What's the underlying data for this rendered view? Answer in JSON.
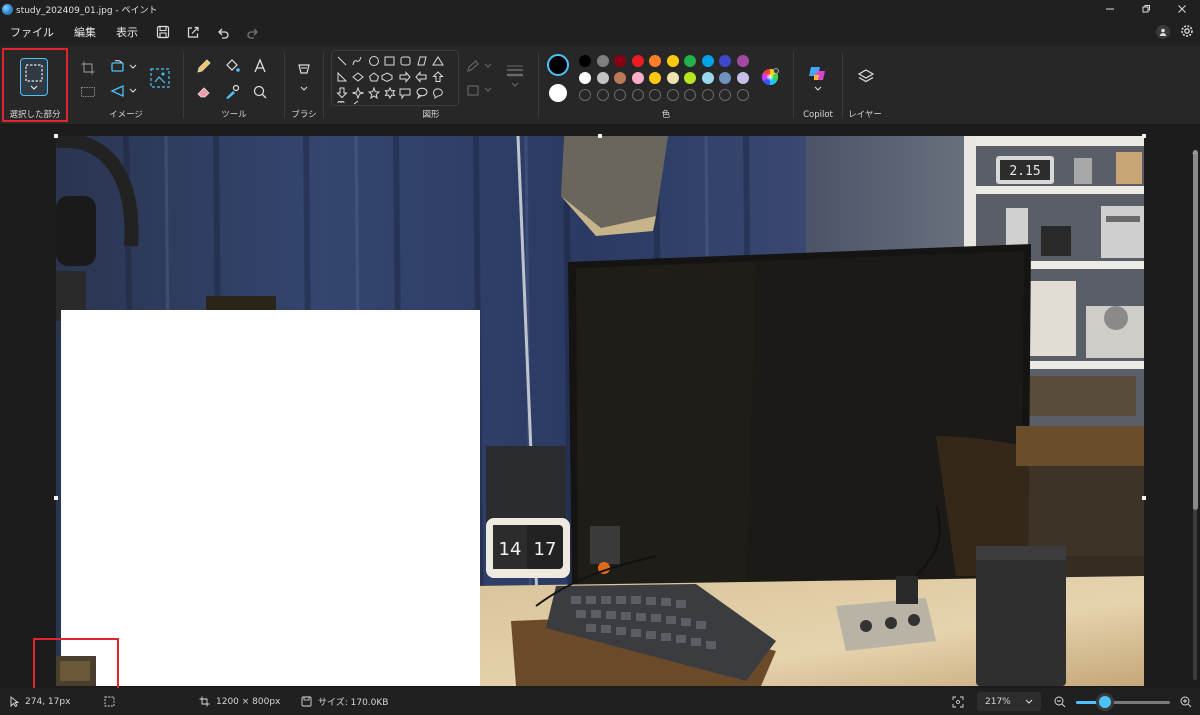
{
  "window": {
    "title": "study_202409_01.jpg - ペイント"
  },
  "menu": {
    "file": "ファイル",
    "edit": "編集",
    "view": "表示"
  },
  "ribbon": {
    "selection_label": "選択した部分",
    "image_label": "イメージ",
    "tools_label": "ツール",
    "brush_label": "ブラシ",
    "shapes_label": "図形",
    "color_label": "色",
    "copilot_label": "Copilot",
    "layers_label": "レイヤー"
  },
  "colors": {
    "primary": "#000000",
    "secondary": "#ffffff",
    "palette_row1": [
      "#000000",
      "#7f7f7f",
      "#880015",
      "#ed1c24",
      "#ff7f27",
      "#ffc90e",
      "#22b14c",
      "#00a2e8",
      "#3f48cc",
      "#a349a4"
    ],
    "palette_row2": [
      "#ffffff",
      "#c3c3c3",
      "#b97a57",
      "#ffaec9",
      "#ffc90e",
      "#efe4b0",
      "#b5e61d",
      "#99d9ea",
      "#7092be",
      "#c8bfe7"
    ],
    "accent": "#4cc2ff",
    "highlight": "#e0262c"
  },
  "canvas": {
    "clock_hours": "14",
    "clock_minutes": "17",
    "shelf_clock": "2.15"
  },
  "status": {
    "cursor_pos": "274, 17px",
    "image_size": "1200 × 800px",
    "file_size": "サイズ: 170.0KB",
    "zoom": "217%",
    "zoom_slider_fraction": 0.28
  }
}
